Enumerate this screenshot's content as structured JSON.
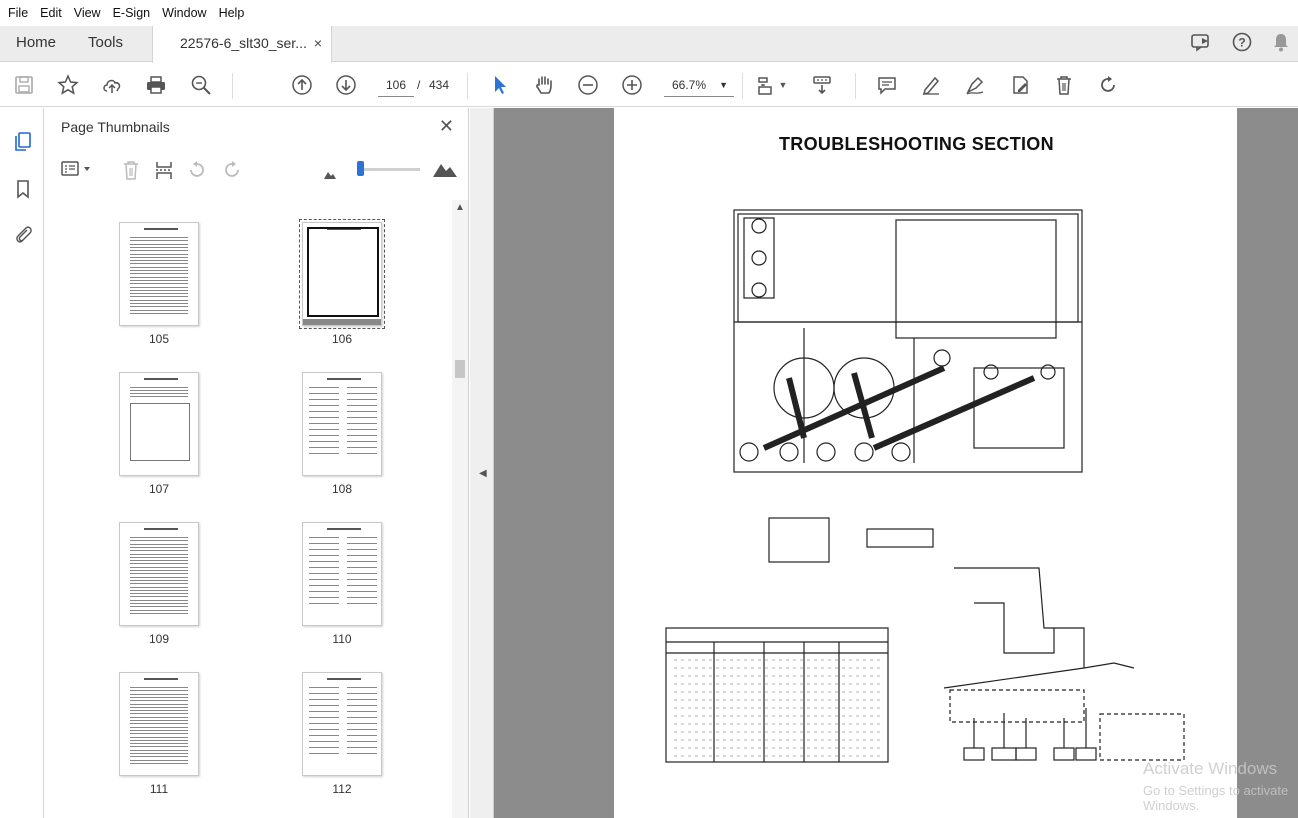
{
  "menubar": {
    "items": [
      "File",
      "Edit",
      "View",
      "E-Sign",
      "Window",
      "Help"
    ]
  },
  "tabs": {
    "home": "Home",
    "tools": "Tools",
    "document": "22576-6_slt30_ser...",
    "close": "×"
  },
  "toolbar": {
    "current_page": "106",
    "separator": "/",
    "total_pages": "434",
    "zoom": "66.7%"
  },
  "panel": {
    "title": "Page Thumbnails",
    "close": "✕"
  },
  "thumbnails": [
    {
      "label": "105"
    },
    {
      "label": "106"
    },
    {
      "label": "107"
    },
    {
      "label": "108"
    },
    {
      "label": "109"
    },
    {
      "label": "110"
    },
    {
      "label": "111"
    },
    {
      "label": "112"
    }
  ],
  "document": {
    "page_title": "TROUBLESHOOTING SECTION"
  },
  "watermark": {
    "line1": "Activate Windows",
    "line2": "Go to Settings to activate Windows."
  },
  "colors": {
    "accent": "#2a74d6",
    "viewer_bg": "#8c8c8c"
  }
}
